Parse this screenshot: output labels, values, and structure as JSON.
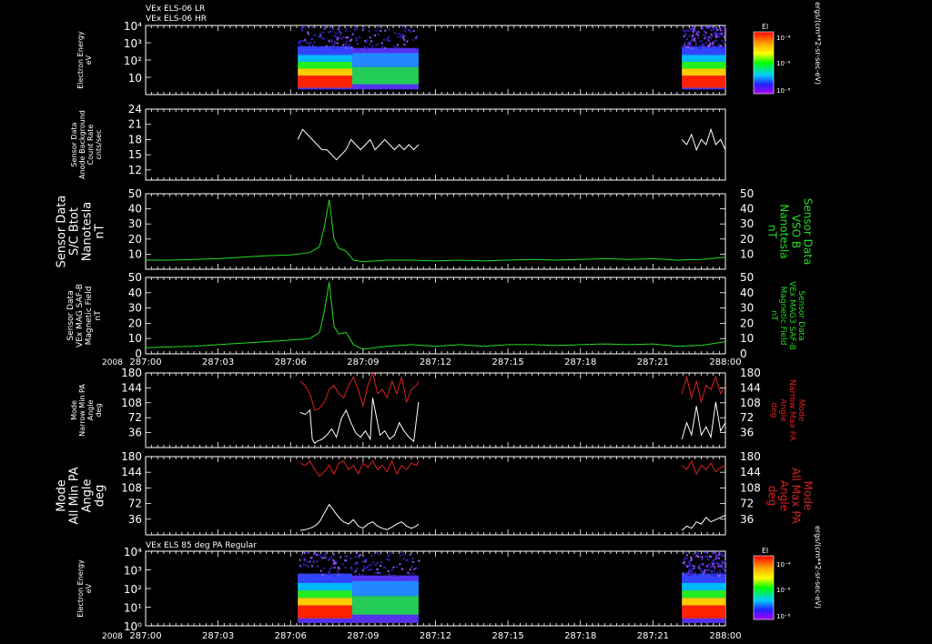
{
  "header": {
    "lines": [
      "VEx ELS-06 LR",
      "VEx ELS-06 HR"
    ],
    "panel7_title": "VEx ELS 85 deg PA Regular"
  },
  "colorbar": {
    "label": "El",
    "ticks": [
      "10⁻⁴",
      "10⁻⁶",
      "10⁻⁸"
    ],
    "unit_top": "ergs/(cm**2-sr-sec-eV)",
    "unit_bottom": "ergs/(cm**2-sr-sec-eV)"
  },
  "time_axis": {
    "year": "2008",
    "ticks": [
      "287:00",
      "287:03",
      "287:06",
      "287:09",
      "287:12",
      "287:15",
      "287:18",
      "287:21",
      "288:00"
    ]
  },
  "colors": {
    "white": "#ffffff",
    "green": "#22dd22",
    "red": "#dd2020"
  },
  "chart_data": [
    {
      "type": "heatmap",
      "ylabel_lines": [
        "Electron Energy",
        "eV"
      ],
      "yticks": [
        "10⁴",
        "10³",
        "10²",
        "10"
      ],
      "ylim": [
        1,
        10000
      ],
      "yscale": "log",
      "data_intervals": [
        [
          "287:06.3",
          "287:11.3"
        ],
        [
          "287:22.2",
          "288:00"
        ]
      ]
    },
    {
      "type": "line",
      "ylabel_lines": [
        "Sensor Data",
        "Anode Background",
        "Count Rate",
        "cnts/sec"
      ],
      "yticks": [
        "24",
        "21",
        "18",
        "15",
        "12"
      ],
      "ylim": [
        10,
        24
      ],
      "series": [
        {
          "color": "white",
          "x": [
            6.3,
            6.5,
            6.7,
            6.9,
            7.1,
            7.3,
            7.5,
            7.7,
            7.9,
            8.1,
            8.3,
            8.5,
            8.7,
            8.9,
            9.1,
            9.3,
            9.5,
            9.7,
            9.9,
            10.1,
            10.3,
            10.5,
            10.7,
            10.9,
            11.1,
            11.3
          ],
          "values": [
            18,
            20,
            19,
            18,
            17,
            16,
            16,
            15,
            14,
            15,
            16,
            18,
            17,
            16,
            17,
            18,
            16,
            17,
            18,
            17,
            16,
            17,
            16,
            17,
            16,
            17
          ],
          "x2": [
            22.2,
            22.4,
            22.6,
            22.8,
            23.0,
            23.2,
            23.4,
            23.6,
            23.8,
            24.0
          ],
          "values2": [
            18,
            17,
            19,
            16,
            18,
            17,
            20,
            17,
            18,
            16
          ]
        }
      ]
    },
    {
      "type": "line",
      "ylabel_lines": [
        "Sensor Data",
        "S/C Btot",
        "Nanotesla",
        "nT"
      ],
      "ylabel_right_lines": [
        "Sensor Data",
        "VSO B",
        "Nanotesla",
        "nT"
      ],
      "yticks": [
        "50",
        "40",
        "30",
        "20",
        "10"
      ],
      "ylim": [
        0,
        50
      ],
      "series": [
        {
          "color": "green",
          "x": [
            0,
            1,
            2,
            3,
            4,
            5,
            6,
            6.8,
            7.2,
            7.4,
            7.6,
            7.8,
            8.0,
            8.3,
            8.6,
            9.0,
            9.5,
            10,
            11,
            12,
            13,
            14,
            15,
            16,
            17,
            18,
            19,
            20,
            21,
            22,
            23,
            24
          ],
          "values": [
            6,
            6,
            6.5,
            7,
            8,
            9,
            9.5,
            11,
            15,
            28,
            46,
            20,
            14,
            12,
            6,
            5,
            5.5,
            6,
            6,
            5.5,
            6,
            5.5,
            6,
            6.5,
            6,
            6.5,
            7,
            6.5,
            7,
            6,
            6.5,
            8
          ]
        }
      ]
    },
    {
      "type": "line",
      "ylabel_lines": [
        "Sensor Data",
        "VEx MAG SAF-B",
        "Magnetic Field",
        "nT"
      ],
      "ylabel_right_lines": [
        "Sensor Data",
        "VEx MAG3 SAF-B",
        "Magnetic Field",
        "nT"
      ],
      "yticks": [
        "50",
        "40",
        "30",
        "20",
        "10",
        "0"
      ],
      "ylim": [
        0,
        50
      ],
      "series": [
        {
          "color": "green",
          "x": [
            0,
            1,
            2,
            3,
            4,
            5,
            6,
            6.8,
            7.2,
            7.4,
            7.6,
            7.8,
            8.0,
            8.3,
            8.6,
            9.0,
            9.5,
            10,
            11,
            12,
            13,
            14,
            15,
            16,
            17,
            18,
            19,
            20,
            21,
            22,
            23,
            24
          ],
          "values": [
            4,
            4.5,
            5,
            6,
            7,
            8,
            9,
            10,
            14,
            28,
            47,
            18,
            13,
            14,
            6,
            3,
            4,
            5,
            6,
            5,
            6,
            5,
            6,
            6,
            5.5,
            6,
            6.5,
            6,
            6.5,
            5,
            5.5,
            8
          ]
        }
      ]
    },
    {
      "type": "line",
      "ylabel_lines": [
        "Mode",
        "Narrow Min PA",
        "Angle",
        "deg"
      ],
      "ylabel_right_lines": [
        "Mode",
        "Narrow Max PA",
        "Angle",
        "deg"
      ],
      "yticks": [
        "180",
        "144",
        "108",
        "72",
        "36"
      ],
      "ylim": [
        0,
        180
      ],
      "series": [
        {
          "color": "white",
          "x": [
            6.4,
            6.6,
            6.8,
            6.9,
            7.0,
            7.1,
            7.3,
            7.5,
            7.7,
            7.9,
            8.1,
            8.3,
            8.5,
            8.7,
            8.9,
            9.1,
            9.3,
            9.4,
            9.5,
            9.7,
            9.9,
            10.1,
            10.3,
            10.5,
            10.7,
            10.9,
            11.1,
            11.3
          ],
          "values": [
            85,
            80,
            90,
            20,
            10,
            15,
            20,
            30,
            45,
            25,
            70,
            90,
            60,
            35,
            25,
            40,
            20,
            120,
            90,
            30,
            40,
            20,
            30,
            60,
            40,
            25,
            15,
            110
          ],
          "x2": [
            22.2,
            22.4,
            22.6,
            22.8,
            23.0,
            23.2,
            23.4,
            23.6,
            23.8,
            24.0
          ],
          "values2": [
            20,
            60,
            30,
            100,
            30,
            50,
            25,
            110,
            40,
            60
          ]
        },
        {
          "color": "red",
          "x": [
            6.4,
            6.6,
            6.8,
            7.0,
            7.2,
            7.4,
            7.6,
            7.8,
            8.0,
            8.2,
            8.4,
            8.6,
            8.8,
            9.0,
            9.2,
            9.4,
            9.6,
            9.8,
            10.0,
            10.2,
            10.4,
            10.6,
            10.8,
            11.0,
            11.2,
            11.3
          ],
          "values": [
            160,
            150,
            130,
            90,
            95,
            110,
            140,
            150,
            130,
            120,
            150,
            170,
            140,
            100,
            150,
            180,
            130,
            140,
            120,
            160,
            130,
            170,
            110,
            140,
            150,
            160
          ],
          "x2": [
            22.2,
            22.4,
            22.6,
            22.8,
            23.0,
            23.2,
            23.4,
            23.6,
            23.8,
            24.0
          ],
          "values2": [
            130,
            170,
            120,
            160,
            110,
            150,
            140,
            170,
            130,
            150
          ]
        }
      ]
    },
    {
      "type": "line",
      "ylabel_lines": [
        "Mode",
        "All Min PA",
        "Angle",
        "deg"
      ],
      "ylabel_right_lines": [
        "Mode",
        "All Max PA",
        "Angle",
        "deg"
      ],
      "yticks": [
        "180",
        "144",
        "108",
        "72",
        "36"
      ],
      "ylim": [
        0,
        180
      ],
      "series": [
        {
          "color": "white",
          "x": [
            6.4,
            6.6,
            6.8,
            7.0,
            7.2,
            7.4,
            7.6,
            7.8,
            8.0,
            8.2,
            8.4,
            8.6,
            8.8,
            9.0,
            9.2,
            9.4,
            9.6,
            9.8,
            10.0,
            10.2,
            10.4,
            10.6,
            10.8,
            11.0,
            11.2,
            11.3
          ],
          "values": [
            10,
            12,
            15,
            20,
            30,
            50,
            70,
            55,
            40,
            30,
            25,
            35,
            20,
            15,
            25,
            30,
            20,
            15,
            12,
            18,
            25,
            30,
            20,
            15,
            20,
            25
          ],
          "x2": [
            22.2,
            22.4,
            22.6,
            22.8,
            23.0,
            23.2,
            23.4,
            23.6,
            23.8,
            24.0
          ],
          "values2": [
            10,
            20,
            15,
            30,
            25,
            40,
            30,
            35,
            40,
            45
          ]
        },
        {
          "color": "red",
          "x": [
            6.4,
            6.6,
            6.8,
            7.0,
            7.2,
            7.4,
            7.6,
            7.8,
            8.0,
            8.2,
            8.4,
            8.6,
            8.8,
            9.0,
            9.2,
            9.4,
            9.6,
            9.8,
            10.0,
            10.2,
            10.4,
            10.6,
            10.8,
            11.0,
            11.2,
            11.3
          ],
          "values": [
            165,
            160,
            170,
            150,
            135,
            145,
            160,
            140,
            165,
            170,
            150,
            160,
            140,
            165,
            155,
            170,
            150,
            160,
            145,
            170,
            140,
            160,
            150,
            165,
            160,
            170
          ],
          "x2": [
            22.2,
            22.4,
            22.6,
            22.8,
            23.0,
            23.2,
            23.4,
            23.6,
            23.8,
            24.0
          ],
          "values2": [
            160,
            150,
            170,
            140,
            160,
            150,
            165,
            145,
            155,
            160
          ]
        }
      ]
    },
    {
      "type": "heatmap",
      "ylabel_lines": [
        "Electron Energy",
        "eV"
      ],
      "yticks": [
        "10⁴",
        "10³",
        "10²",
        "10¹",
        "10⁰"
      ],
      "ylim": [
        1,
        10000
      ],
      "yscale": "log",
      "data_intervals": [
        [
          "287:06.3",
          "287:11.3"
        ],
        [
          "287:22.2",
          "288:00"
        ]
      ]
    }
  ]
}
